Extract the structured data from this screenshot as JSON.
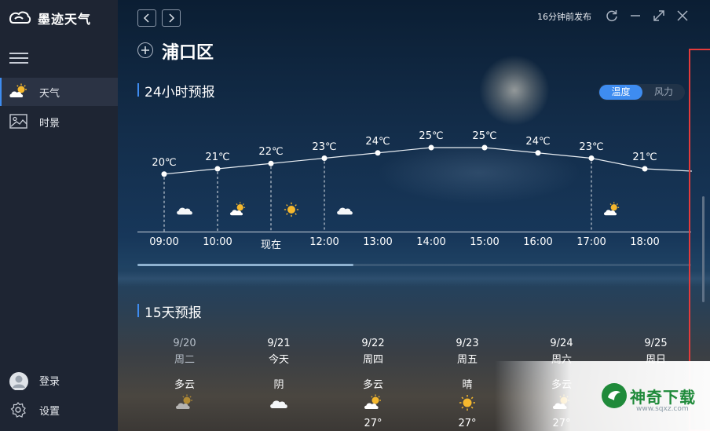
{
  "app": {
    "name": "墨迹天气"
  },
  "sidebar": {
    "items": [
      {
        "label": "天气",
        "icon": "partly-cloudy-icon",
        "active": true
      },
      {
        "label": "时景",
        "icon": "image-icon",
        "active": false
      }
    ],
    "login_label": "登录",
    "settings_label": "设置"
  },
  "titlebar": {
    "publish_time": "16分钟前发布"
  },
  "city": {
    "name": "浦口区"
  },
  "hourly": {
    "title": "24小时预报",
    "toggle": {
      "temp": "温度",
      "wind": "风力",
      "selected": "temp"
    },
    "hours": [
      {
        "time": "09:00",
        "temp": 20,
        "temp_label": "20℃",
        "icon": "cloudy-icon"
      },
      {
        "time": "10:00",
        "temp": 21,
        "temp_label": "21℃",
        "icon": "partly-cloudy-icon"
      },
      {
        "time": "现在",
        "temp": 22,
        "temp_label": "22℃",
        "icon": "sunny-icon"
      },
      {
        "time": "12:00",
        "temp": 23,
        "temp_label": "23℃",
        "icon": "cloudy-icon"
      },
      {
        "time": "13:00",
        "temp": 24,
        "temp_label": "24℃",
        "icon": ""
      },
      {
        "time": "14:00",
        "temp": 25,
        "temp_label": "25℃",
        "icon": ""
      },
      {
        "time": "15:00",
        "temp": 25,
        "temp_label": "25℃",
        "icon": ""
      },
      {
        "time": "16:00",
        "temp": 24,
        "temp_label": "24℃",
        "icon": ""
      },
      {
        "time": "17:00",
        "temp": 23,
        "temp_label": "23℃",
        "icon": "partly-cloudy-icon"
      },
      {
        "time": "18:00",
        "temp": 21,
        "temp_label": "21℃",
        "icon": ""
      }
    ]
  },
  "daily": {
    "title": "15天预报",
    "days": [
      {
        "date": "9/20",
        "week": "周二",
        "condition": "多云",
        "icon": "partly-cloudy-icon",
        "past": true,
        "temp": ""
      },
      {
        "date": "9/21",
        "week": "今天",
        "condition": "阴",
        "icon": "cloudy-icon",
        "past": false,
        "temp": ""
      },
      {
        "date": "9/22",
        "week": "周四",
        "condition": "多云",
        "icon": "partly-cloudy-icon",
        "past": false,
        "temp": "27°"
      },
      {
        "date": "9/23",
        "week": "周五",
        "condition": "晴",
        "icon": "sunny-icon",
        "past": false,
        "temp": "27°"
      },
      {
        "date": "9/24",
        "week": "周六",
        "condition": "多云",
        "icon": "partly-cloudy-icon",
        "past": false,
        "temp": "27°"
      },
      {
        "date": "9/25",
        "week": "周日",
        "condition": "",
        "icon": "",
        "past": false,
        "temp": ""
      }
    ]
  },
  "watermark": {
    "text": "神奇下载",
    "url": "www.sqxz.com"
  }
}
